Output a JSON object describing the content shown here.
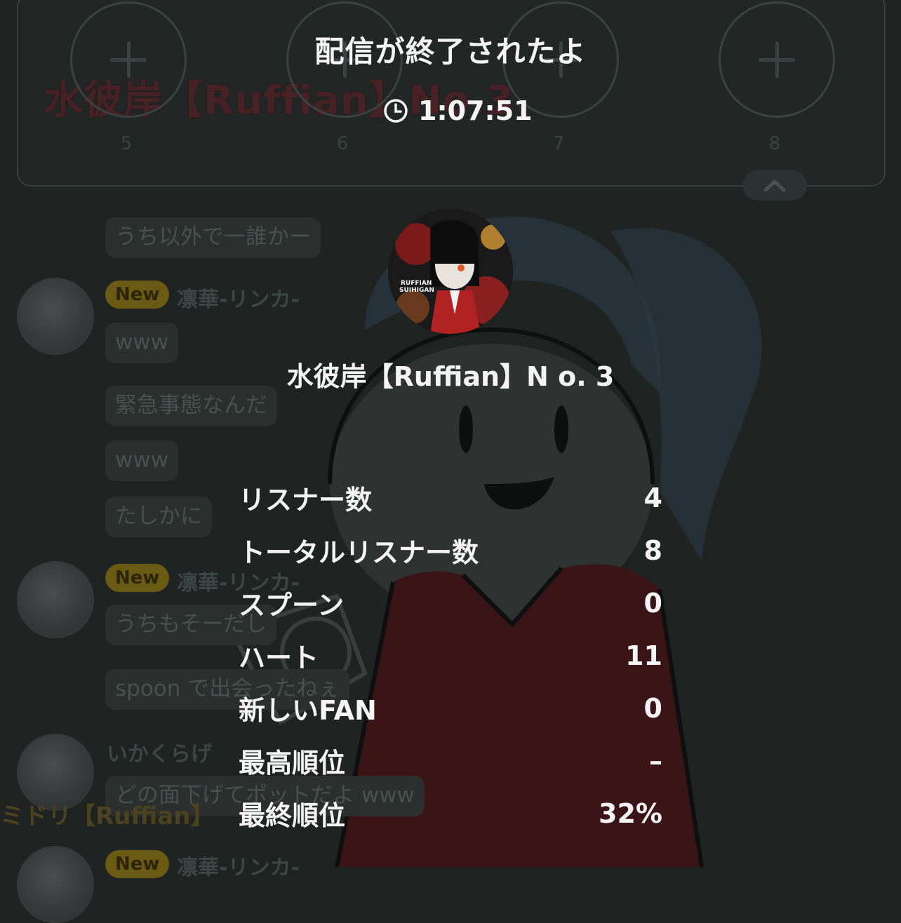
{
  "background": {
    "stream_title": "水彼岸【Ruffian】No.3",
    "slots": [
      {
        "number": "5"
      },
      {
        "number": "6"
      },
      {
        "number": "7"
      },
      {
        "number": "8"
      }
    ],
    "chat": [
      {
        "type": "message",
        "text": "うち以外で一誰かー"
      },
      {
        "type": "user",
        "badge": "New",
        "name": "凛華-リンカ-"
      },
      {
        "type": "message",
        "text": "www"
      },
      {
        "type": "message",
        "text": "緊急事態なんだ"
      },
      {
        "type": "message",
        "text": "www"
      },
      {
        "type": "message",
        "text": "たしかに"
      },
      {
        "type": "user",
        "badge": "New",
        "name": "凛華-リンカ-"
      },
      {
        "type": "message",
        "text": "うちもそーだし"
      },
      {
        "type": "message",
        "text": "spoon で出会ったねぇ"
      },
      {
        "type": "user",
        "name": "いかくらげ"
      },
      {
        "type": "message",
        "text": "どの面下げてポットだよ www"
      },
      {
        "type": "user",
        "badge": "New",
        "name": "凛華-リンカ-"
      }
    ],
    "footer_name": "ミドリ【Ruffian】"
  },
  "overlay": {
    "title": "配信が終了されたよ",
    "duration": "1:07:51",
    "host_name": "水彼岸【Ruffian】N o.  3",
    "stats": [
      {
        "label": "リスナー数",
        "value": "4"
      },
      {
        "label": "トータルリスナー数",
        "value": "8"
      },
      {
        "label": "スプーン",
        "value": "0"
      },
      {
        "label": "ハート",
        "value": "11"
      },
      {
        "label": "新しいFAN",
        "value": "0"
      },
      {
        "label": "最高順位",
        "value": "–"
      },
      {
        "label": "最終順位",
        "value": "32%"
      }
    ]
  },
  "colors": {
    "background": "#1f2423",
    "text": "#f4f4f4",
    "new_badge": "#6b5a14",
    "title_red": "#5a1b20"
  },
  "icons": [
    "plus-icon",
    "chevron-up-icon",
    "clock-icon"
  ]
}
